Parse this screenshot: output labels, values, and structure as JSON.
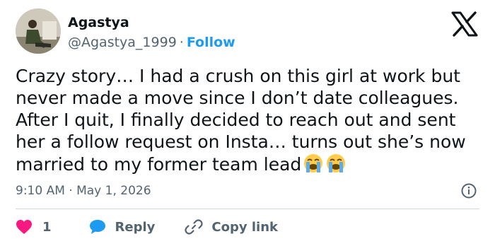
{
  "author": {
    "name": "Agastya",
    "handle": "@Agastya_1999",
    "separator": "·",
    "follow_label": "Follow"
  },
  "brand": {
    "logo_icon": "x-logo-icon",
    "color": "#0f1419"
  },
  "tweet": {
    "text": "Crazy story… I had a crush on this girl at work but\nnever made a move since I don’t date colleagues.\nAfter I quit, I finally decided to reach out and sent\nher a follow request on Insta… turns out she’s now\nmarried to my former team lead",
    "emojis": [
      "loudly-crying-face-emoji",
      "loudly-crying-face-emoji"
    ],
    "timestamp": "9:10 AM · May 1, 2026"
  },
  "actions": {
    "like_count": "1",
    "reply_label": "Reply",
    "copy_link_label": "Copy link"
  },
  "colors": {
    "link_blue": "#1d9bf0",
    "like_red": "#f91880",
    "muted": "#536471",
    "divider": "#cfd9de"
  }
}
